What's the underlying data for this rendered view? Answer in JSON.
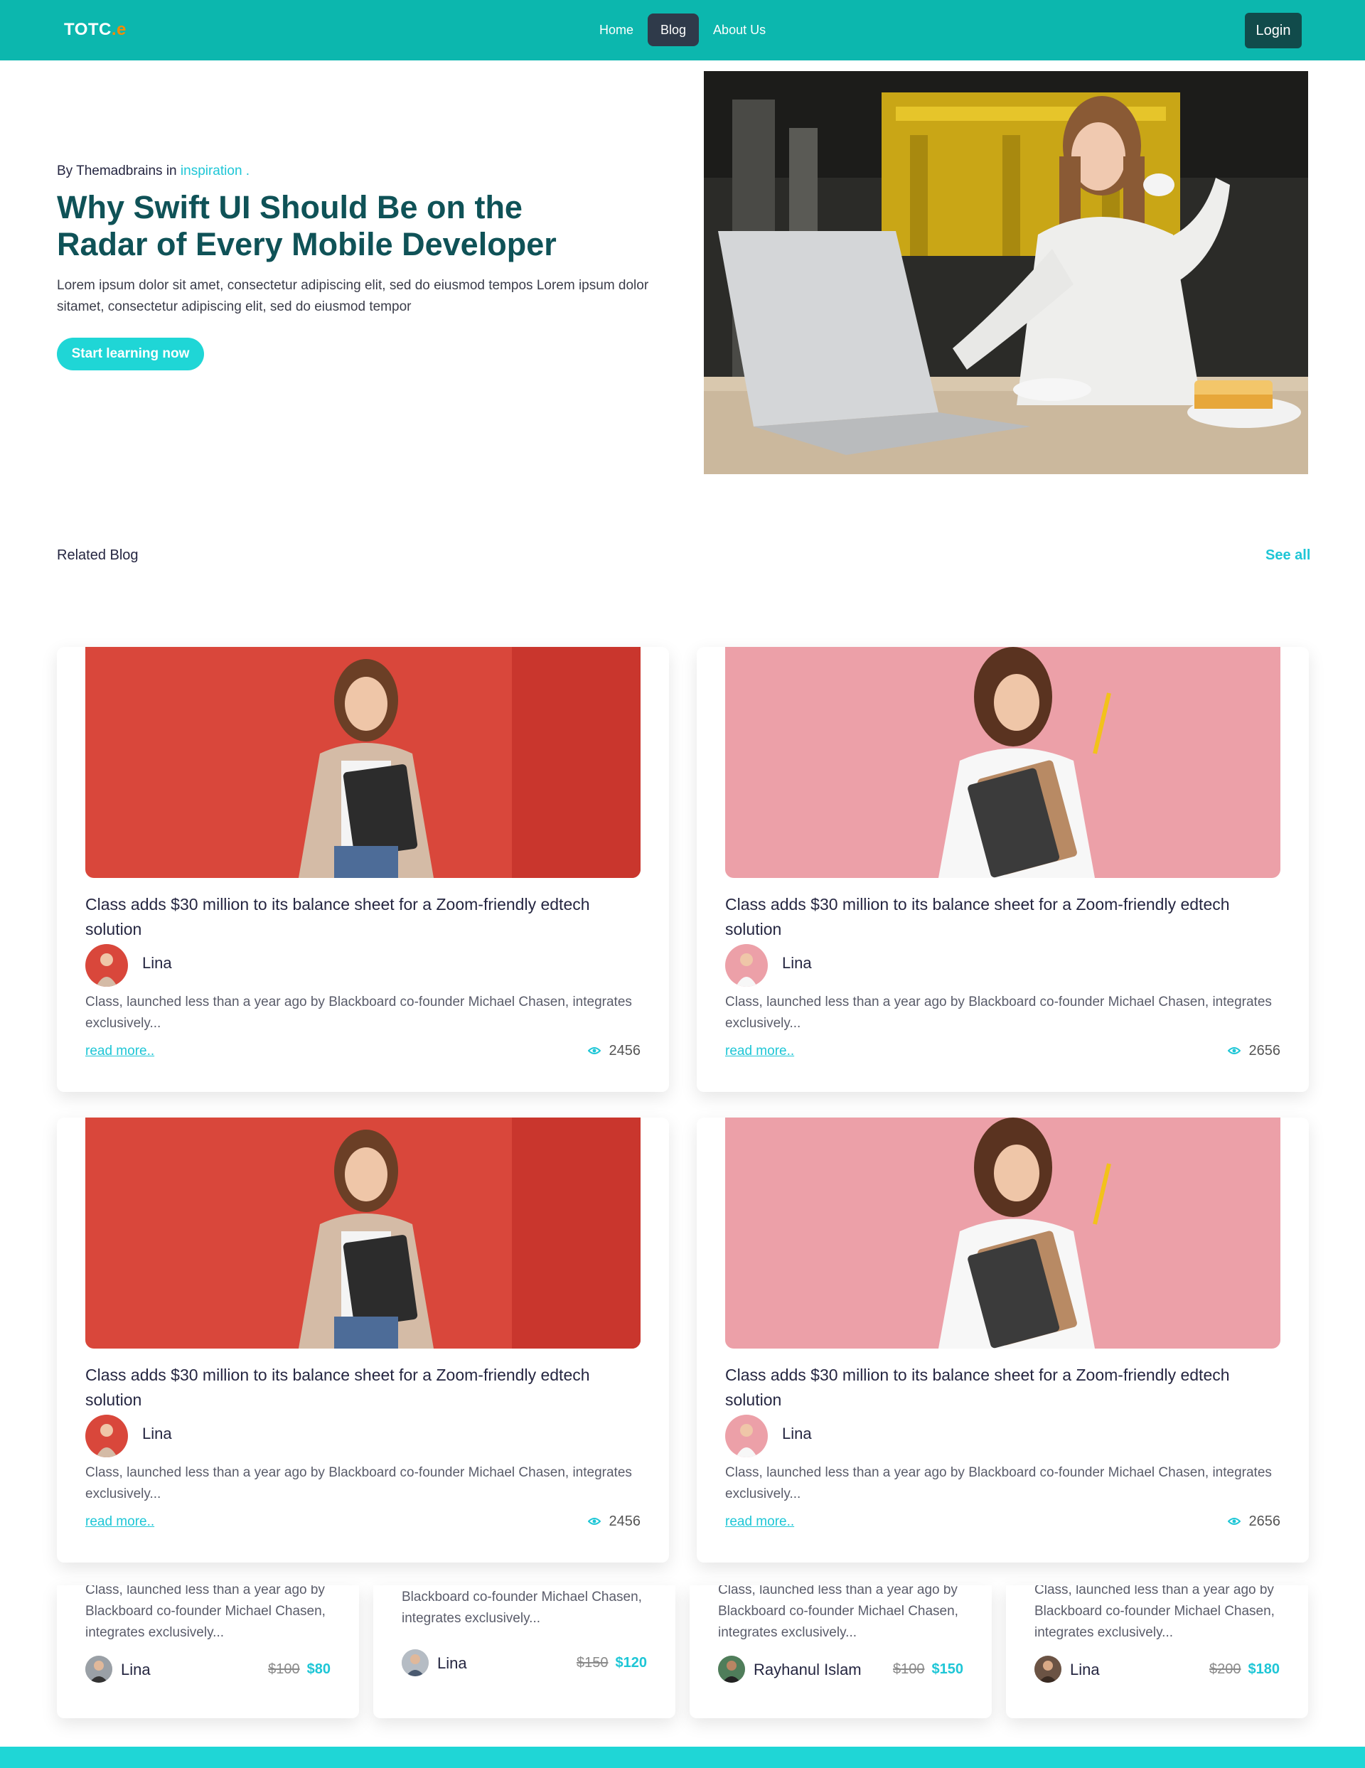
{
  "navbar": {
    "logo_text": "TOTC",
    "logo_dot": ".e",
    "links": [
      {
        "label": "Home"
      },
      {
        "label": "Blog",
        "active": true
      },
      {
        "label": "About Us"
      }
    ],
    "login_label": "Login",
    "bg_color": "#0cb7ae"
  },
  "hero": {
    "byline_prefix": "By Themadbrains in ",
    "category": "inspiration .",
    "title": "Why Swift UI Should Be on the Radar of Every Mobile Developer",
    "description": "Lorem ipsum dolor sit amet, consectetur adipiscing elit, sed do eiusmod tempos Lorem ipsum dolor sitamet, consectetur adipiscing elit, sed do eiusmod tempor",
    "cta_label": "Start learning now"
  },
  "related": {
    "title": "Related Blog",
    "see_all": "See all",
    "cards": [
      {
        "title": "Class adds $30 million to its balance sheet for a Zoom-friendly edtech solution",
        "author": "Lina",
        "desc": "Class, launched less than a year ago by Blackboard co-founder Michael Chasen, integrates exclusively...",
        "read_more": "read more..",
        "views": "2456",
        "theme": "red"
      },
      {
        "title": "Class adds $30 million to its balance sheet for a Zoom-friendly edtech solution",
        "author": "Lina",
        "desc": "Class, launched less than a year ago by Blackboard co-founder Michael Chasen, integrates exclusively...",
        "read_more": "read more..",
        "views": "2656",
        "theme": "pink"
      },
      {
        "title": "Class adds $30 million to its balance sheet for a Zoom-friendly edtech solution",
        "author": "Lina",
        "desc": "Class, launched less than a year ago by Blackboard co-founder Michael Chasen, integrates exclusively...",
        "read_more": "read more..",
        "views": "2456",
        "theme": "red"
      },
      {
        "title": "Class adds $30 million to its balance sheet for a Zoom-friendly edtech solution",
        "author": "Lina",
        "desc": "Class, launched less than a year ago by Blackboard co-founder Michael Chasen, integrates exclusively...",
        "read_more": "read more..",
        "views": "2656",
        "theme": "pink"
      }
    ]
  },
  "courses": [
    {
      "desc": "Class, launched less than a year ago by Blackboard co-founder Michael Chasen, integrates exclusively...",
      "author": "Lina",
      "old_price": "$100",
      "new_price": "$80"
    },
    {
      "desc": "Blackboard co-founder Michael Chasen, integrates exclusively...",
      "author": "Lina",
      "old_price": "$150",
      "new_price": "$120"
    },
    {
      "desc": "Class, launched less than a year ago by Blackboard co-founder Michael Chasen, integrates exclusively...",
      "author": "Rayhanul Islam",
      "old_price": "$100",
      "new_price": "$150"
    },
    {
      "desc": "Class, launched less than a year ago by Blackboard co-founder Michael Chasen, integrates exclusively...",
      "author": "Lina",
      "old_price": "$200",
      "new_price": "$180"
    }
  ],
  "colors": {
    "accent": "#1ec6d6",
    "title": "#0f5257",
    "login_bg": "#114b4b"
  }
}
